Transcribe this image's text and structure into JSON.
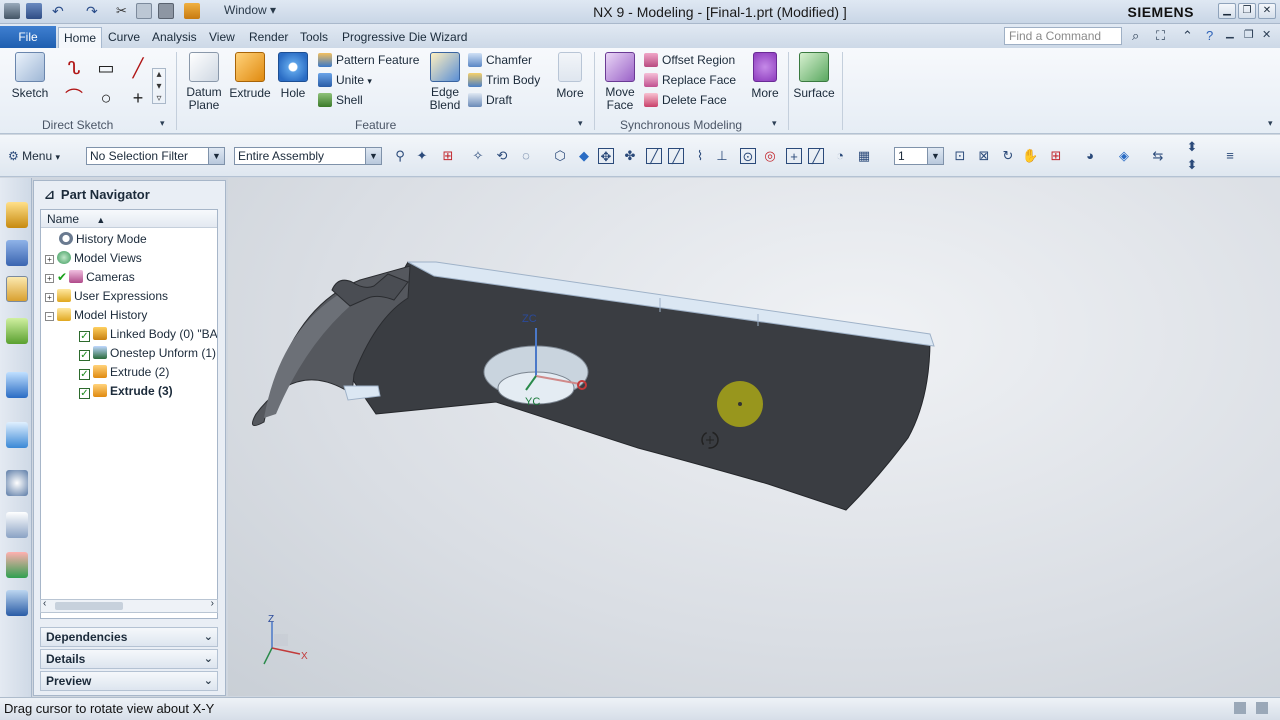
{
  "window": {
    "title": "NX 9 - Modeling - [Final-1.prt (Modified) ]",
    "brand": "SIEMENS",
    "window_menu": "Window"
  },
  "ribbon_tabs": [
    "File",
    "Home",
    "Curve",
    "Analysis",
    "View",
    "Render",
    "Tools",
    "Progressive Die Wizard"
  ],
  "find_command_placeholder": "Find a Command",
  "groups": {
    "direct_sketch": {
      "label": "Direct Sketch",
      "sketch": "Sketch"
    },
    "feature": {
      "label": "Feature",
      "datum_plane": "Datum Plane",
      "extrude": "Extrude",
      "hole": "Hole",
      "pattern_feature": "Pattern Feature",
      "unite": "Unite",
      "shell": "Shell",
      "edge_blend": "Edge Blend",
      "chamfer": "Chamfer",
      "trim_body": "Trim Body",
      "draft": "Draft",
      "more": "More"
    },
    "sync": {
      "label": "Synchronous Modeling",
      "move_face": "Move Face",
      "offset_region": "Offset Region",
      "replace_face": "Replace Face",
      "delete_face": "Delete Face",
      "more": "More"
    },
    "surface": {
      "label": "Surface"
    }
  },
  "selection_bar": {
    "menu": "Menu",
    "filter": "No Selection Filter",
    "scope": "Entire Assembly",
    "layer": "1"
  },
  "navigator": {
    "title": "Part Navigator",
    "column": "Name",
    "items": [
      {
        "label": "History Mode"
      },
      {
        "label": "Model Views"
      },
      {
        "label": "Cameras"
      },
      {
        "label": "User Expressions"
      },
      {
        "label": "Model History"
      },
      {
        "label": "Linked Body (0) \"BA"
      },
      {
        "label": "Onestep Unform (1)"
      },
      {
        "label": "Extrude (2)"
      },
      {
        "label": "Extrude (3)"
      }
    ],
    "panels": [
      "Dependencies",
      "Details",
      "Preview"
    ]
  },
  "viewport": {
    "axis_labels": {
      "zc": "ZC",
      "yc": "YC",
      "z": "Z",
      "x": "X"
    }
  },
  "status": {
    "message": "Drag cursor to rotate view about X-Y"
  },
  "colors": {
    "file_tab": "#2a6cc4",
    "part_body": "#3a3d42",
    "part_top_edge": "#dbe7f3",
    "cursor_dot": "#a9a616"
  }
}
